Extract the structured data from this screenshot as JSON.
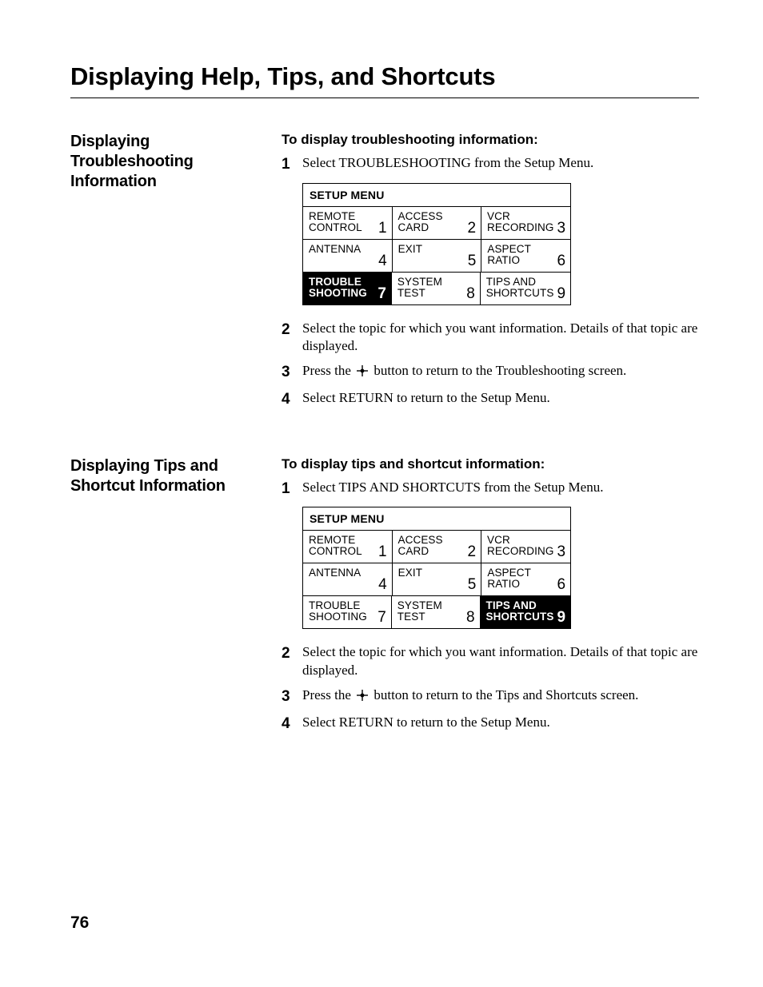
{
  "page": {
    "title": "Displaying Help, Tips, and Shortcuts",
    "number": "76"
  },
  "menu_title": "SETUP MENU",
  "cells": [
    {
      "label": "REMOTE\nCONTROL",
      "idx": "1"
    },
    {
      "label": "ACCESS\nCARD",
      "idx": "2"
    },
    {
      "label": "VCR\nRECORDING",
      "idx": "3"
    },
    {
      "label": "ANTENNA",
      "idx": "4"
    },
    {
      "label": "EXIT",
      "idx": "5"
    },
    {
      "label": "ASPECT\nRATIO",
      "idx": "6"
    },
    {
      "label": "TROUBLE\nSHOOTING",
      "idx": "7"
    },
    {
      "label": "SYSTEM\nTEST",
      "idx": "8"
    },
    {
      "label": "TIPS AND\nSHORTCUTS",
      "idx": "9"
    }
  ],
  "sections": [
    {
      "heading": "Displaying Troubleshooting Information",
      "lead": "To display troubleshooting information:",
      "selected_idx": "7",
      "steps": [
        {
          "n": "1",
          "text": "Select TROUBLESHOOTING from the Setup Menu.",
          "has_menu_after": true
        },
        {
          "n": "2",
          "text": "Select the topic for which you want information. Details of that topic are displayed."
        },
        {
          "n": "3",
          "pre": "Press the ",
          "post": " button to return to the Troubleshooting screen.",
          "icon": true
        },
        {
          "n": "4",
          "text": "Select RETURN to return to the Setup Menu."
        }
      ]
    },
    {
      "heading": "Displaying Tips and Shortcut Information",
      "lead": "To display tips and shortcut information:",
      "selected_idx": "9",
      "steps": [
        {
          "n": "1",
          "text": "Select TIPS AND SHORTCUTS from the Setup Menu.",
          "has_menu_after": true
        },
        {
          "n": "2",
          "text": "Select the topic for which you want information. Details of that topic are displayed."
        },
        {
          "n": "3",
          "pre": "Press the ",
          "post": " button to return to the Tips and Shortcuts screen.",
          "icon": true
        },
        {
          "n": "4",
          "text": "Select RETURN to return to the Setup Menu."
        }
      ]
    }
  ]
}
